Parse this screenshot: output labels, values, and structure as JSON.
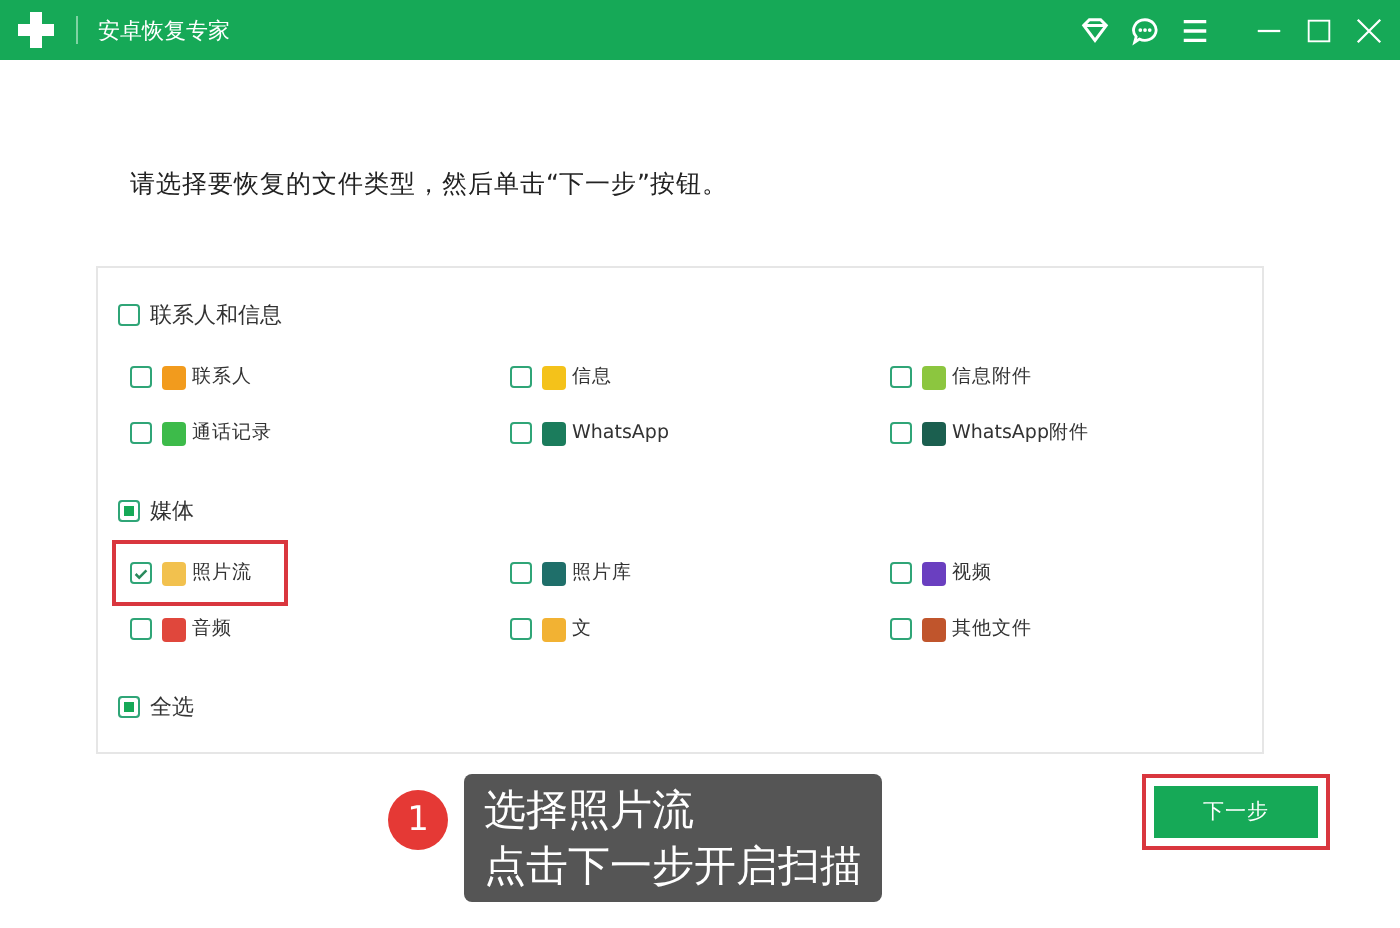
{
  "window": {
    "title": "安卓恢复专家"
  },
  "instruction": "请选择要恢复的文件类型，然后单击“下一步”按钮。",
  "groups": [
    {
      "label": "联系人和信息",
      "mixed": false,
      "items": [
        {
          "label": "联系人",
          "checked": false,
          "highlighted": false
        },
        {
          "label": "信息",
          "checked": false,
          "highlighted": false
        },
        {
          "label": "信息附件",
          "checked": false,
          "highlighted": false
        },
        {
          "label": "通话记录",
          "checked": false,
          "highlighted": false
        },
        {
          "label": "WhatsApp",
          "checked": false,
          "highlighted": false
        },
        {
          "label": "WhatsApp附件",
          "checked": false,
          "highlighted": false
        }
      ]
    },
    {
      "label": "媒体",
      "mixed": true,
      "items": [
        {
          "label": "照片流",
          "checked": true,
          "highlighted": true
        },
        {
          "label": "照片库",
          "checked": false,
          "highlighted": false
        },
        {
          "label": "视频",
          "checked": false,
          "highlighted": false
        },
        {
          "label": "音频",
          "checked": false,
          "highlighted": false
        },
        {
          "label": "文",
          "checked": false,
          "highlighted": false
        },
        {
          "label": "其他文件",
          "checked": false,
          "highlighted": false
        }
      ]
    }
  ],
  "select_all": {
    "label": "全选",
    "mixed": true
  },
  "callout": {
    "badge": "1",
    "lines": [
      "选择照片流",
      "点击下一步开启扫描"
    ]
  },
  "next_button": {
    "label": "下一步",
    "highlighted": true
  }
}
